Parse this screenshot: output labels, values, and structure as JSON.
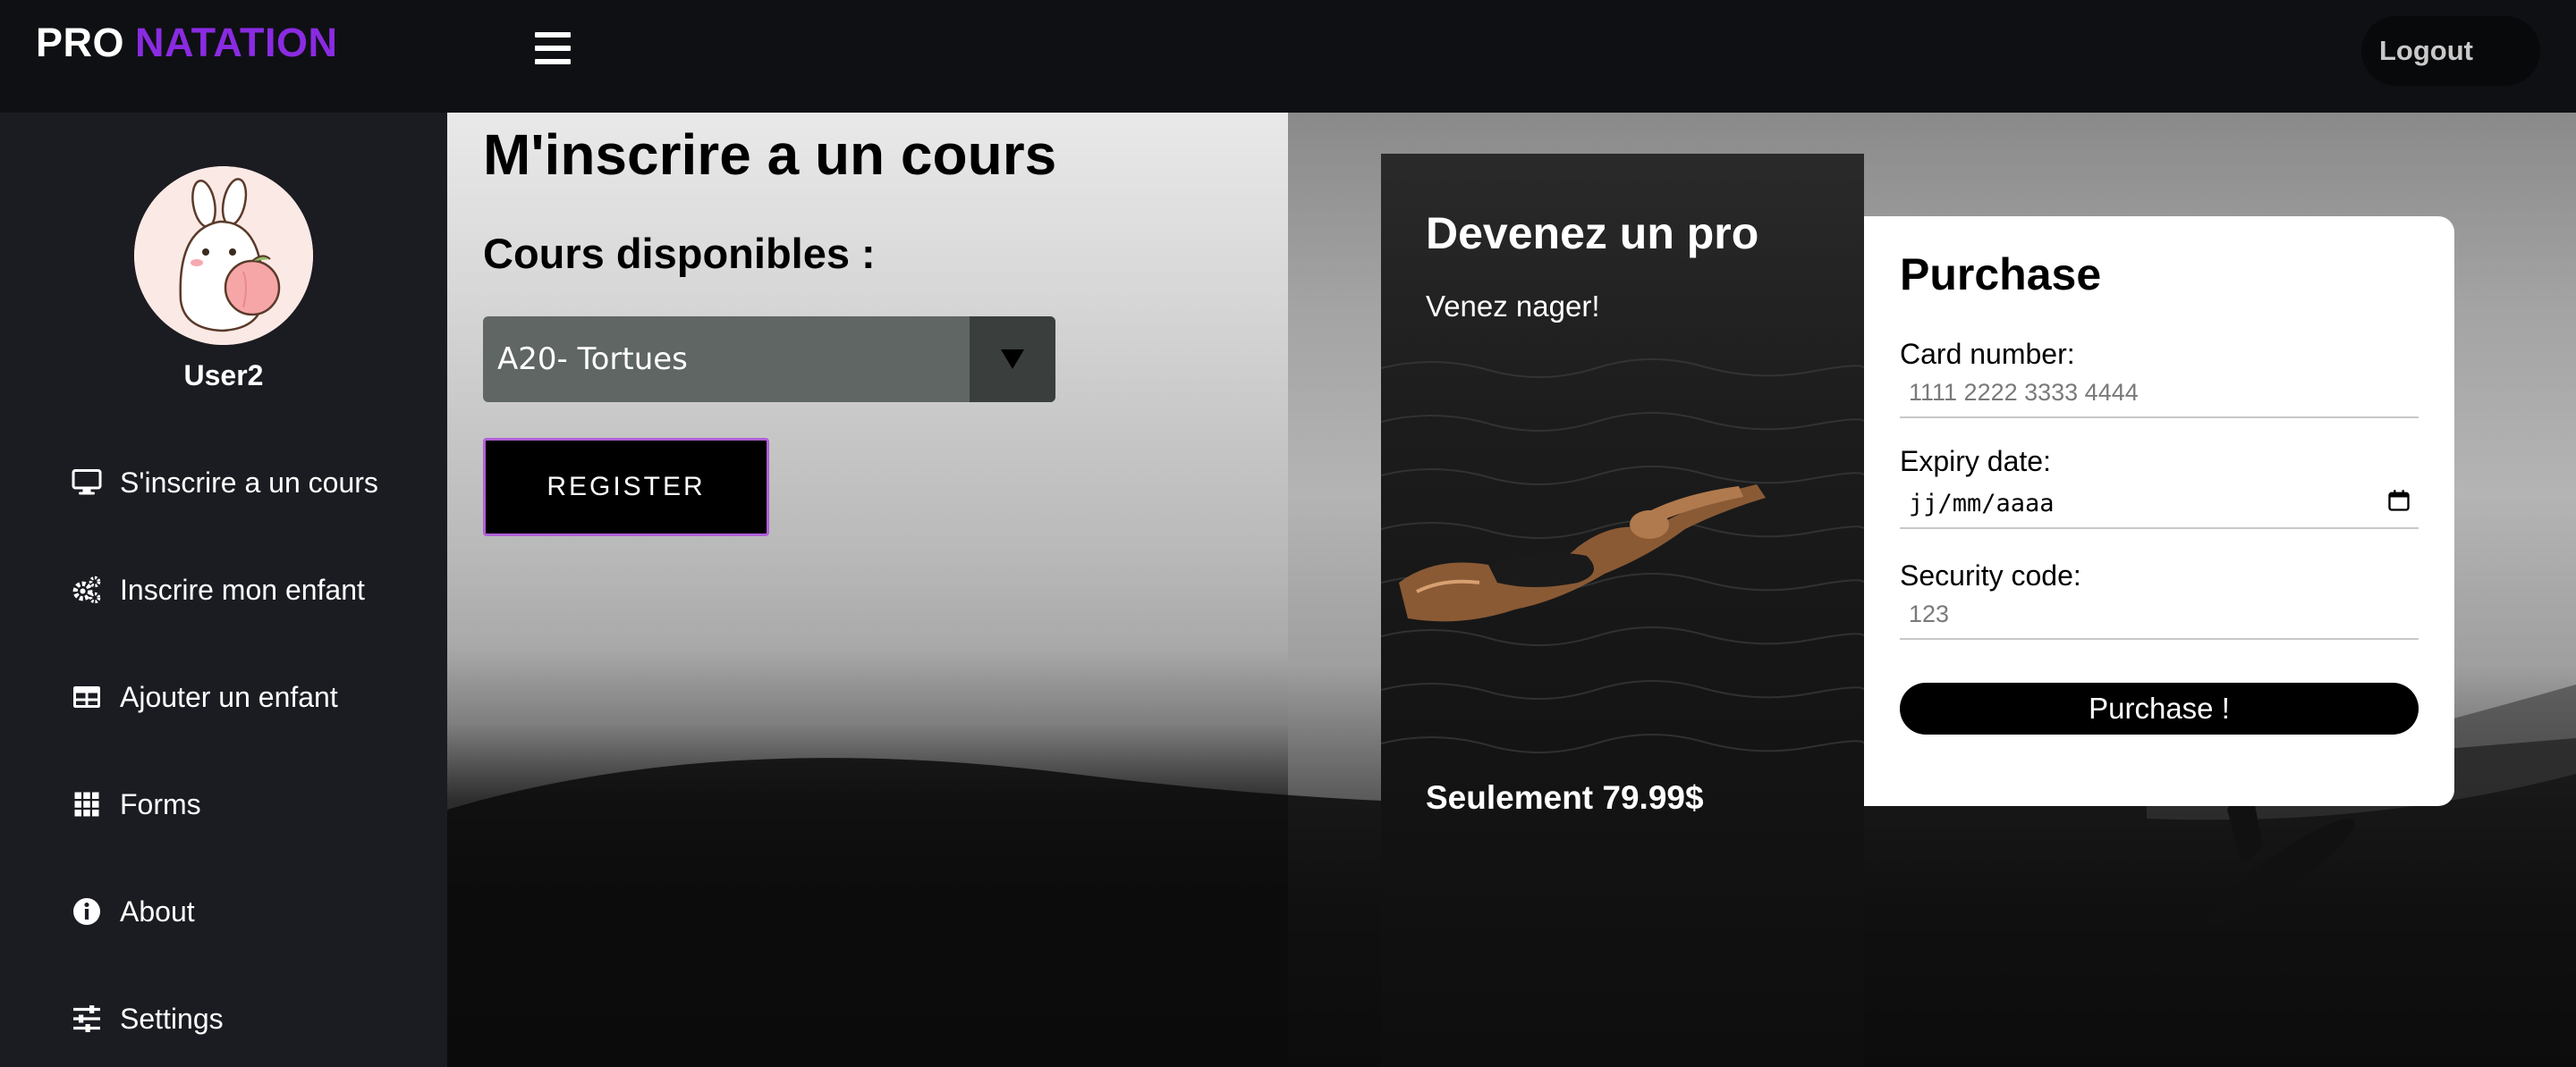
{
  "brand": {
    "part1": "PRO",
    "part2": "NATATION"
  },
  "header": {
    "logout_label": "Logout"
  },
  "sidebar": {
    "username": "User2",
    "items": [
      {
        "label": "S'inscrire a un cours",
        "icon": "monitor-icon"
      },
      {
        "label": "Inscrire mon enfant",
        "icon": "gears-icon"
      },
      {
        "label": "Ajouter un enfant",
        "icon": "table-icon"
      },
      {
        "label": "Forms",
        "icon": "grid-icon"
      },
      {
        "label": "About",
        "icon": "info-icon"
      },
      {
        "label": "Settings",
        "icon": "sliders-icon"
      }
    ]
  },
  "main": {
    "title": "M'inscrire a un cours",
    "section_title": "Cours disponibles :",
    "course_selected": "A20- Tortues",
    "register_label": "REGISTER"
  },
  "promo": {
    "title": "Devenez un pro",
    "subtitle": "Venez nager!",
    "price": "Seulement 79.99$"
  },
  "purchase": {
    "title": "Purchase",
    "card_label": "Card number:",
    "card_placeholder": "1111 2222 3333 4444",
    "expiry_label": "Expiry date:",
    "expiry_placeholder": "jj/mm/aaaa",
    "security_label": "Security code:",
    "security_placeholder": "123",
    "button_label": "Purchase !"
  },
  "colors": {
    "brand_accent": "#8a2be2",
    "register_border": "#b061d6",
    "sidebar_bg": "#1b1c22",
    "topbar_bg": "#0f1014"
  }
}
